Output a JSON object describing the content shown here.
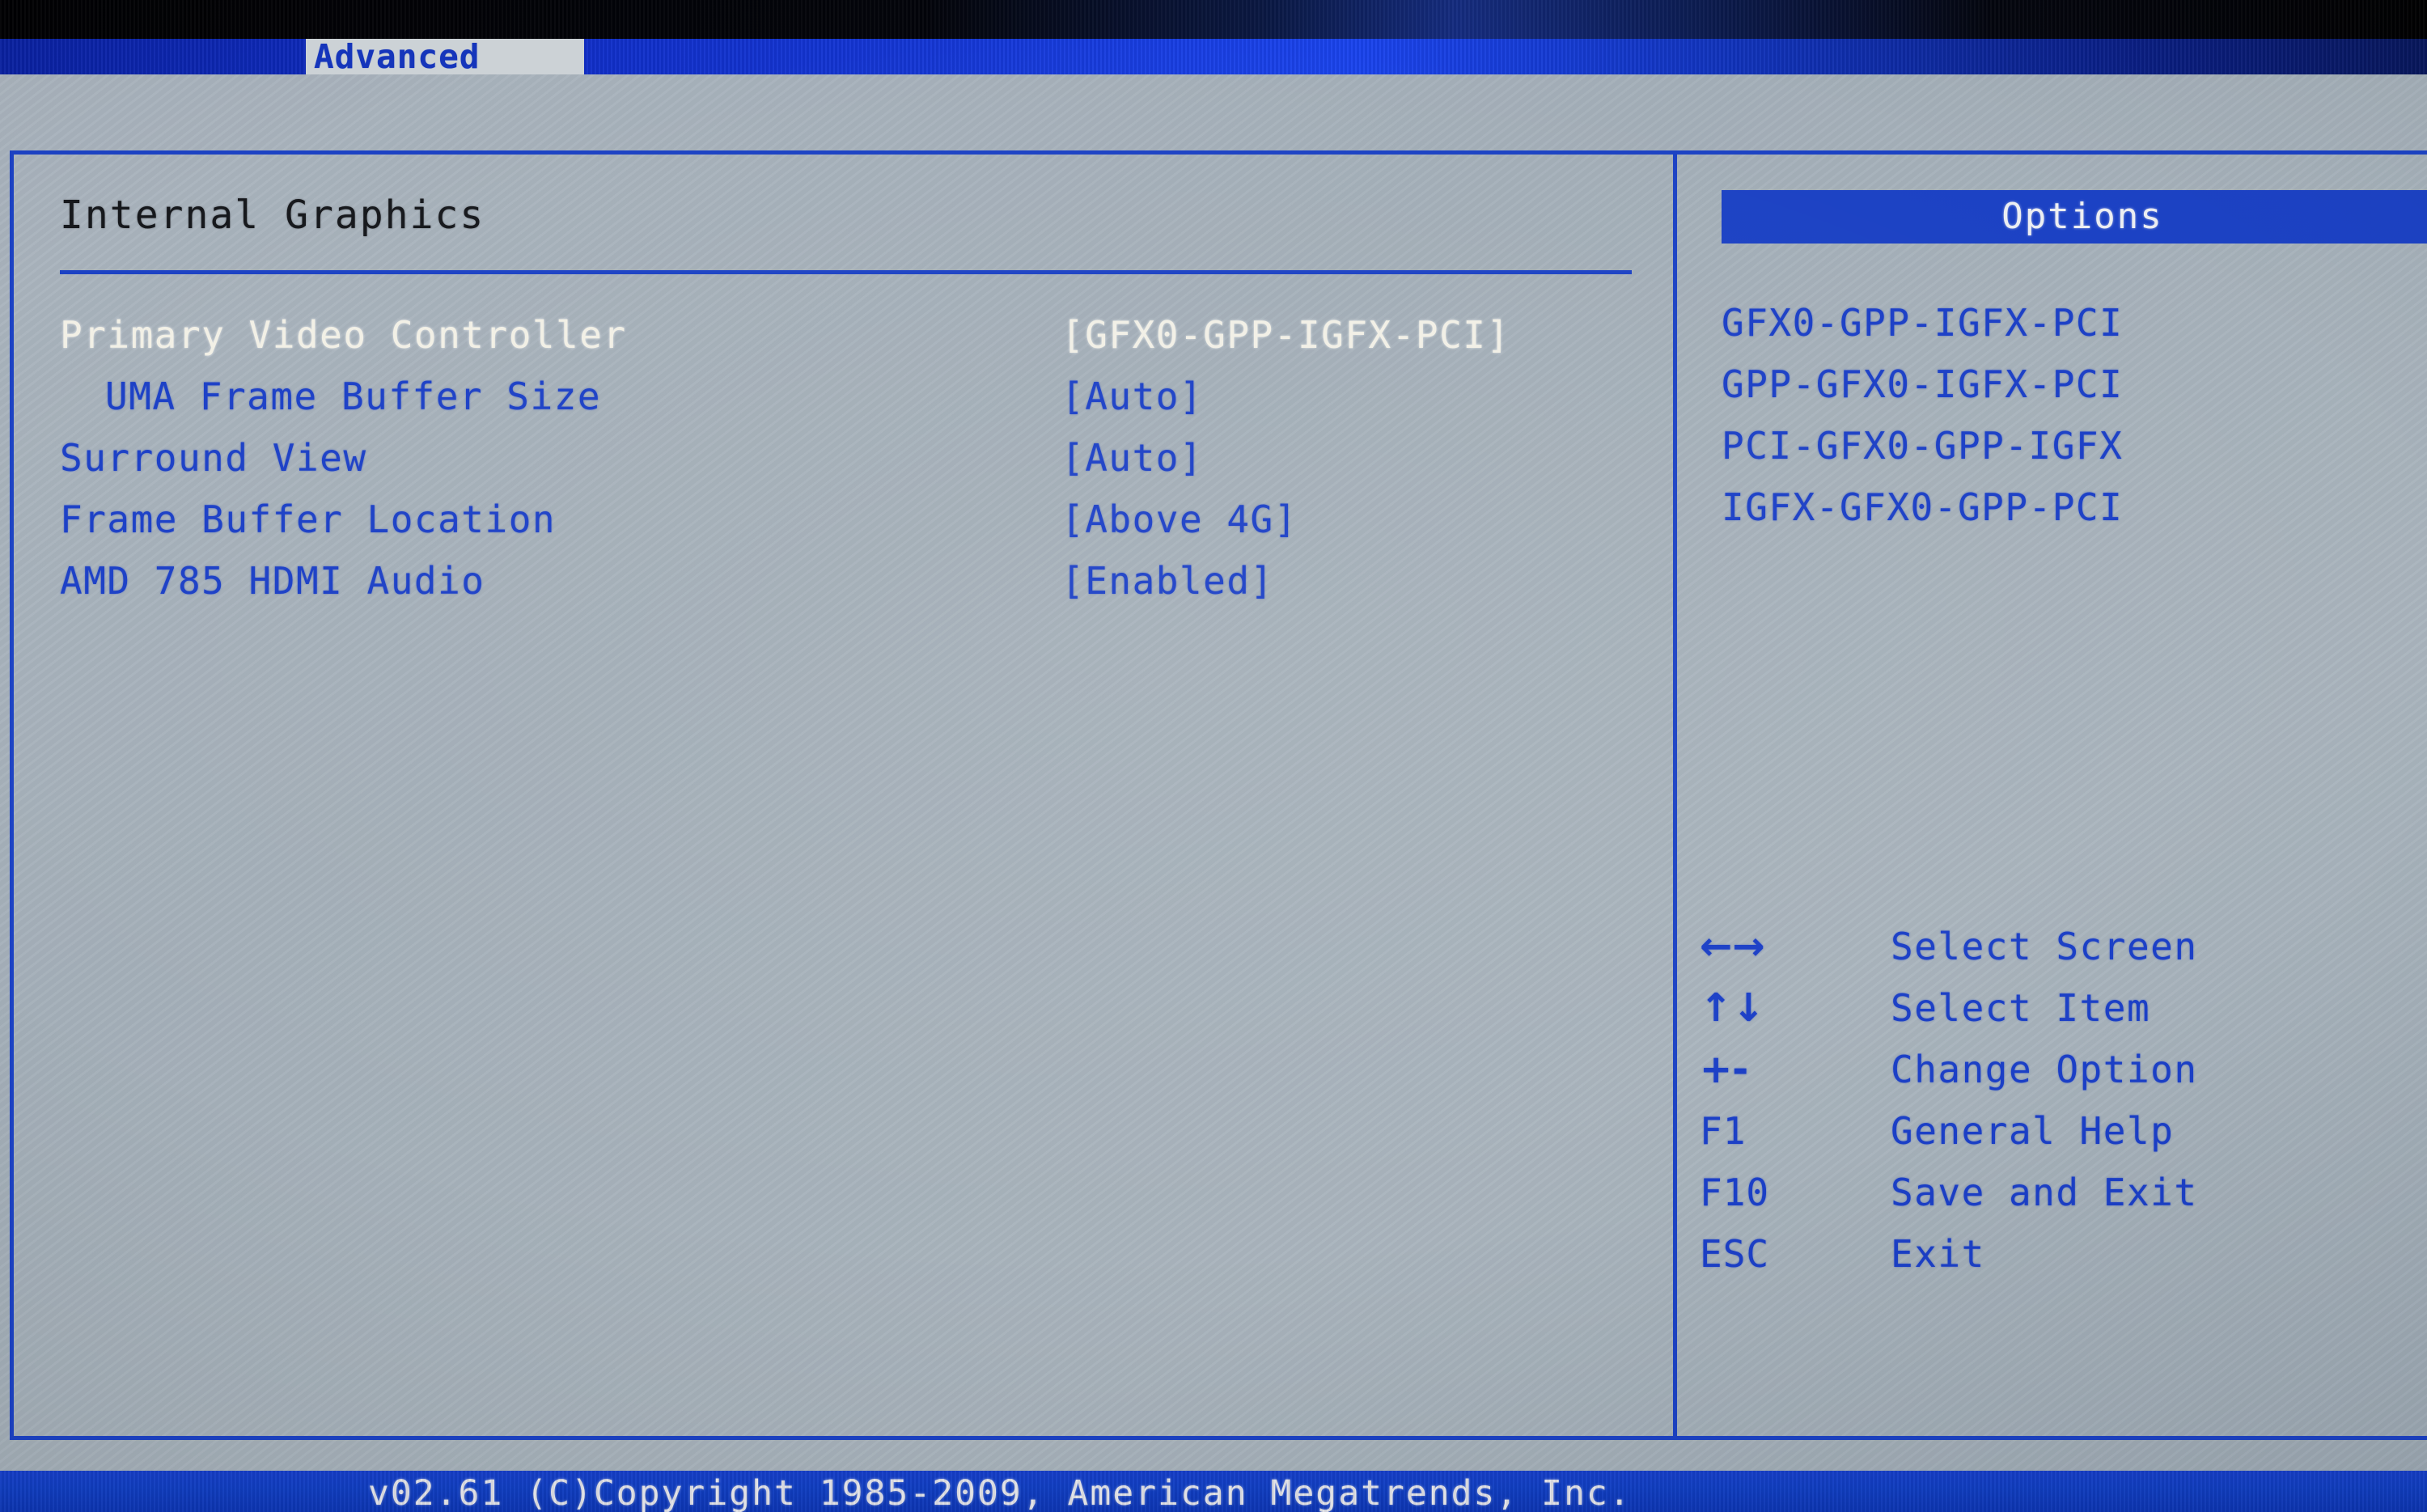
{
  "menubar": {
    "active_tab": "Advanced"
  },
  "left_pane": {
    "section_title": "Internal Graphics",
    "settings": [
      {
        "label": "Primary Video Controller",
        "value": "[GFX0-GPP-IGFX-PCI]",
        "selected": true,
        "indent": false
      },
      {
        "label": "UMA Frame Buffer Size",
        "value": "[Auto]",
        "selected": false,
        "indent": true
      },
      {
        "label": "Surround View",
        "value": "[Auto]",
        "selected": false,
        "indent": false
      },
      {
        "label": "Frame Buffer Location",
        "value": "[Above 4G]",
        "selected": false,
        "indent": false
      },
      {
        "label": "AMD 785 HDMI Audio",
        "value": "[Enabled]",
        "selected": false,
        "indent": false
      }
    ]
  },
  "right_pane": {
    "options_header": "Options",
    "options": [
      "GFX0-GPP-IGFX-PCI",
      "GPP-GFX0-IGFX-PCI",
      "PCI-GFX0-GPP-IGFX",
      "IGFX-GFX0-GPP-PCI"
    ],
    "key_help": [
      {
        "key": "←→",
        "icon": "left-right-arrow-icon",
        "desc": "Select Screen"
      },
      {
        "key": "↑↓",
        "icon": "up-down-arrow-icon",
        "desc": "Select Item"
      },
      {
        "key": "+-",
        "icon": "plus-minus-icon",
        "desc": "Change Option"
      },
      {
        "key": "F1",
        "icon": "f1-key",
        "desc": "General Help"
      },
      {
        "key": "F10",
        "icon": "f10-key",
        "desc": "Save and Exit"
      },
      {
        "key": "ESC",
        "icon": "esc-key",
        "desc": "Exit"
      }
    ]
  },
  "footer": {
    "copyright": "v02.61 (C)Copyright 1985-2009, American Megatrends, Inc."
  },
  "colors": {
    "accent_blue": "#1c42c4",
    "text_blue": "#1b3fc6",
    "selected_white": "#f2f0e6",
    "panel_gray": "#a8b3bd",
    "title_black": "#16181c"
  }
}
